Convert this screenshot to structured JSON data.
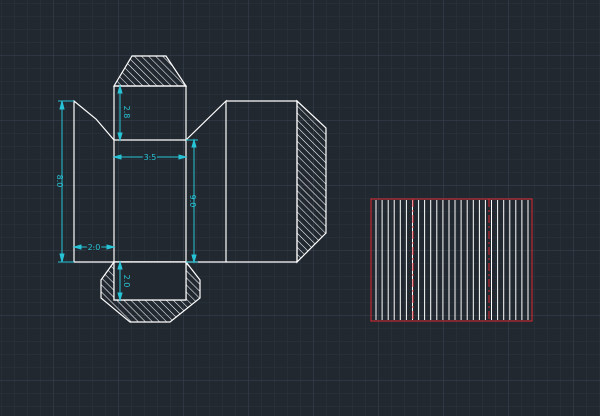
{
  "colors": {
    "background": "#212830",
    "grid_minor": "#2b3340",
    "grid_major": "#3a4452",
    "geometry": "#ffffff",
    "dimension": "#27c4d6",
    "panel_outline": "#e0282e",
    "panel_dashdot": "#e0282e"
  },
  "dimensions": {
    "height_total": "8.0",
    "top_tab_depth": "2.8",
    "face_width": "3.5",
    "side_height": "9.0",
    "left_flap_width": "2.0",
    "bottom_tab_depth": "2.0"
  },
  "preview_panel": {
    "hatch_line_count": 26
  }
}
